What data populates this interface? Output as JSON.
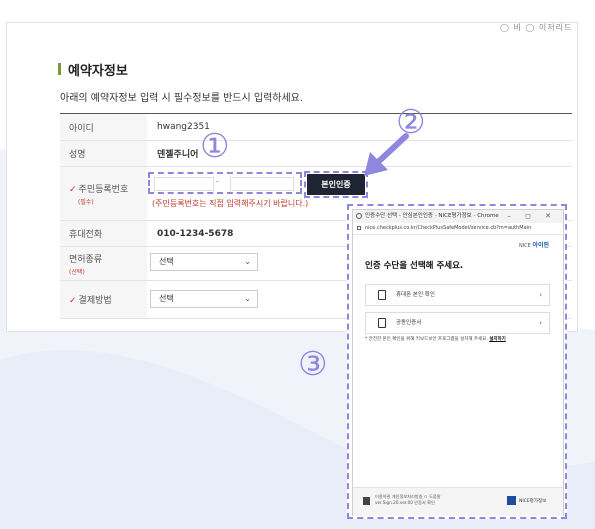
{
  "top_right": "◯ 비  ◯ 이저리드",
  "section": {
    "title": "예약자정보",
    "description": "아래의 예약자정보 입력 시 필수정보를 반드시 입력하세요."
  },
  "form": {
    "id_label": "아이디",
    "id_value": "hwang2351",
    "name_label": "성명",
    "name_value": "덴젤주니어",
    "ssn_label": "주민등록번호",
    "ssn_sub": "(필수)",
    "ssn_dash": "-",
    "verify_button": "본인인증",
    "ssn_warning": "(주민등록번호는 직접 입력해주시기 바랍니다.)",
    "phone_label": "휴대전화",
    "phone_value": "010-1234-5678",
    "license_label": "면허종류",
    "license_sub": "(선택)",
    "license_select": "선택",
    "payment_label": "결제방법",
    "payment_select": "선택"
  },
  "annotations": {
    "one": "①",
    "two": "②",
    "three": "③"
  },
  "popup": {
    "window_title": "인증수단 선택 - 안심본인인증 - NICE평가정보 - Chrome",
    "window_controls": "–  ◻  ✕",
    "address": "nice.checkplus.co.kr/CheckPlusSafeModel/service.cb?m=authMain",
    "brand_prefix": "NICE",
    "brand_name": "아이핀",
    "heading": "인증 수단을 선택해 주세요.",
    "option_phone": "휴대폰 본인 확인",
    "option_cert": "공동인증서",
    "note_text": "* 안전한 본인 확인을 위해 키보드보안 프로그램을 설치해 주세요.",
    "note_link": "설치하기",
    "footer_line1": "이용약관  개인정보처리방침  ㅁ 도움말",
    "footer_line2": "ver.Sign.26.ver.00 인증서 확인",
    "footer_brand": "NICE평가정보"
  },
  "colors": {
    "annotation": "#8f86dd",
    "button": "#1f2433",
    "required": "#c0392b",
    "accent_bar": "#7a9a3a"
  }
}
